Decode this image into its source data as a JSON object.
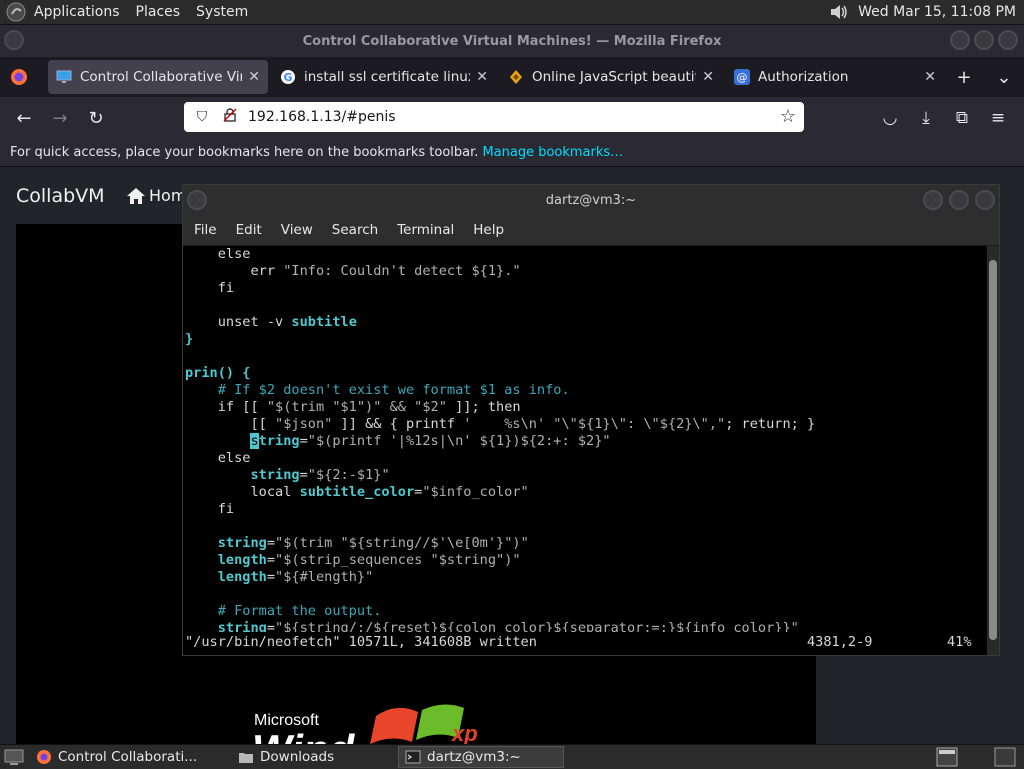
{
  "top_panel": {
    "menus": [
      "Applications",
      "Places",
      "System"
    ],
    "clock": "Wed Mar 15, 11:08 PM"
  },
  "firefox": {
    "window_title": "Control Collaborative Virtual Machines! — Mozilla Firefox",
    "tabs": [
      {
        "label": "Control Collaborative Virtua",
        "icon": "monitor-icon",
        "active": true
      },
      {
        "label": "install ssl certificate linux - G",
        "icon": "google-icon",
        "active": false
      },
      {
        "label": "Online JavaScript beautifier",
        "icon": "beautifier-icon",
        "active": false
      },
      {
        "label": "Authorization",
        "icon": "at-icon",
        "active": false
      }
    ],
    "url": "192.168.1.13/#penis",
    "bookmarks_text": "For quick access, place your bookmarks here on the bookmarks toolbar.",
    "bookmarks_link": "Manage bookmarks…"
  },
  "page": {
    "brand": "CollabVM",
    "home_label": "Hom",
    "xp_microsoft": "Microsoft",
    "xp_windows": "Wind",
    "xp_xp": "xp"
  },
  "terminal": {
    "title": "dartz@vm3:~",
    "menu": [
      "File",
      "Edit",
      "View",
      "Search",
      "Terminal",
      "Help"
    ],
    "status_left": "\"/usr/bin/neofetch\" 10571L, 341608B written",
    "status_pos": "4381,2-9",
    "status_pct": "41%"
  },
  "taskbar": {
    "tasks": [
      {
        "label": "Control Collaborati...",
        "icon": "firefox-icon"
      },
      {
        "label": "Downloads",
        "icon": "folder-icon"
      },
      {
        "label": "dartz@vm3:~",
        "icon": "terminal-icon"
      }
    ]
  },
  "colors": {
    "terminal_bold": "#4ec9d0",
    "terminal_comment": "#3aa8b8",
    "link": "#00ddff"
  }
}
